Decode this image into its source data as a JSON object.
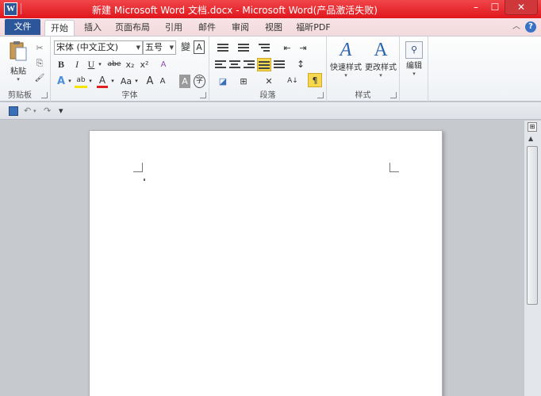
{
  "window": {
    "app_icon": "W",
    "title": "新建 Microsoft Word 文档.docx - Microsoft Word(产品激活失败)",
    "minimize": "–",
    "maximize": "☐",
    "close": "✕"
  },
  "tabs": {
    "file": "文件",
    "items": [
      {
        "label": "开始"
      },
      {
        "label": "插入"
      },
      {
        "label": "页面布局"
      },
      {
        "label": "引用"
      },
      {
        "label": "邮件"
      },
      {
        "label": "审阅"
      },
      {
        "label": "视图"
      },
      {
        "label": "福昕PDF"
      }
    ],
    "help": "?",
    "collapse": "︿"
  },
  "ribbon": {
    "clipboard": {
      "label": "剪贴板",
      "paste": "粘贴",
      "cut": "✂",
      "copy": "⎘",
      "format_painter": "🖌"
    },
    "font": {
      "label": "字体",
      "font_name": "宋体 (中文正文)",
      "font_size": "五号",
      "phonetic": "變",
      "char_border": "A",
      "bold": "B",
      "italic": "I",
      "underline": "U",
      "strike": "abe",
      "subscript": "x₂",
      "superscript": "x²",
      "clear_format": "A",
      "text_effect": "A",
      "highlight": "ab",
      "font_color": "A",
      "change_case": "Aa",
      "grow": "A",
      "shrink": "A",
      "char_shading": "A",
      "enclose": "字"
    },
    "paragraph": {
      "label": "段落",
      "decrease_indent": "⇤",
      "increase_indent": "⇥",
      "line_spacing": "↕",
      "sort": "A↓",
      "show_marks": "¶"
    },
    "styles": {
      "label": "样式",
      "quick_styles": "快速样式",
      "change_styles": "更改样式"
    },
    "editing": {
      "label": "编辑"
    }
  },
  "qat": {
    "undo": "↶",
    "redo": "↷",
    "customize": "▾"
  }
}
